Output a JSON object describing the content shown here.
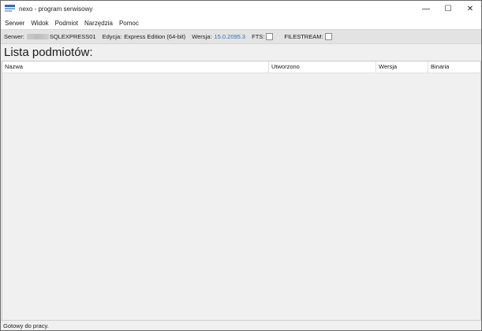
{
  "window": {
    "title": "nexo - program serwisowy",
    "icon": "nexo-app-icon",
    "icon_text": "nexo",
    "controls": {
      "minimize": "—",
      "maximize": "☐",
      "close": "✕"
    }
  },
  "menu": {
    "items": [
      {
        "label": "Serwer"
      },
      {
        "label": "Widok"
      },
      {
        "label": "Podmiot"
      },
      {
        "label": "Narzędzia"
      },
      {
        "label": "Pomoc"
      }
    ]
  },
  "server_info": {
    "server_label": "Serwer:",
    "server_value": "SQLEXPRESS01",
    "edition_label": "Edycja:",
    "edition_value": "Express Edition (64-bit)",
    "version_label": "Wersja:",
    "version_value": "15.0.2095.3",
    "fts_label": "FTS:",
    "fts_checked": false,
    "filestream_label": "FILESTREAM:",
    "filestream_checked": false,
    "link_color": "#2f6fb8"
  },
  "main": {
    "title": "Lista podmiotów:",
    "columns": [
      {
        "label": "Nazwa"
      },
      {
        "label": "Utworzono"
      },
      {
        "label": "Wersja"
      },
      {
        "label": "Binaria"
      }
    ],
    "rows": []
  },
  "status": {
    "text": "Gotowy do pracy."
  }
}
